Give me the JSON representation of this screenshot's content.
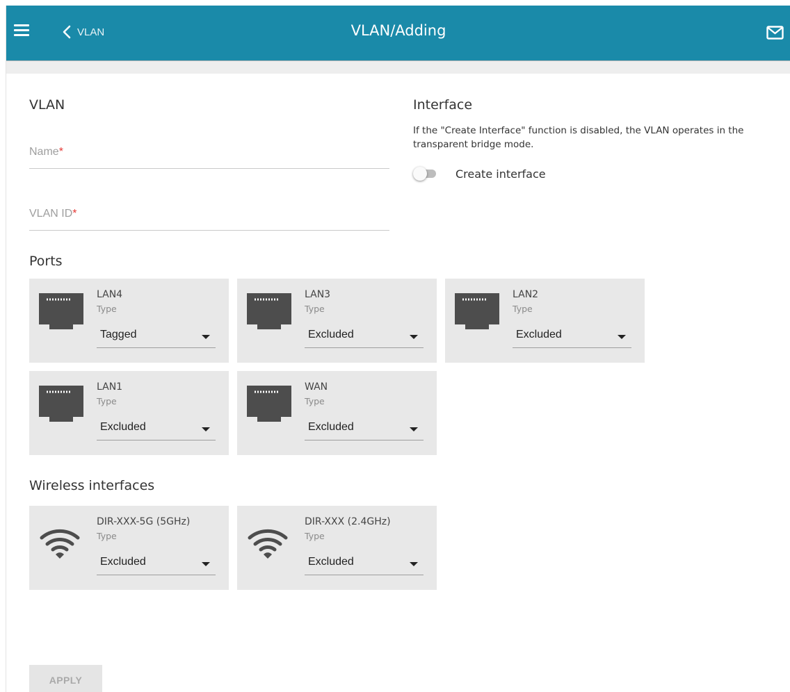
{
  "header": {
    "back_label": "VLAN",
    "title": "VLAN/Adding",
    "menu_icon": "hamburger-icon",
    "mail_icon": "envelope-icon",
    "color": "#1a8aa9"
  },
  "vlan": {
    "title": "VLAN",
    "name_placeholder": "Name",
    "vlan_id_placeholder": "VLAN ID",
    "required_mark": "*"
  },
  "interface": {
    "title": "Interface",
    "description": "If the \"Create Interface\" function is disabled, the VLAN operates in the transparent bridge mode.",
    "toggle_label": "Create interface",
    "toggle_on": false
  },
  "ports": {
    "title": "Ports",
    "type_label": "Type",
    "items": [
      {
        "name": "LAN4",
        "type_value": "Tagged"
      },
      {
        "name": "LAN3",
        "type_value": "Excluded"
      },
      {
        "name": "LAN2",
        "type_value": "Excluded"
      },
      {
        "name": "LAN1",
        "type_value": "Excluded"
      },
      {
        "name": "WAN",
        "type_value": "Excluded"
      }
    ]
  },
  "wireless": {
    "title": "Wireless interfaces",
    "type_label": "Type",
    "items": [
      {
        "name": "DIR-XXX-5G (5GHz)",
        "type_value": "Excluded"
      },
      {
        "name": "DIR-XXX (2.4GHz)",
        "type_value": "Excluded"
      }
    ]
  },
  "apply_label": "APPLY"
}
